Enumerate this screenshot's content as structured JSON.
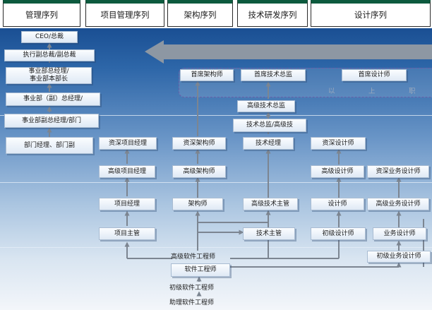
{
  "header": {
    "tabs": [
      {
        "id": "management",
        "label": "管理序列"
      },
      {
        "id": "project-management",
        "label": "项目管理序列"
      },
      {
        "id": "architecture",
        "label": "架构序列"
      },
      {
        "id": "tech-development",
        "label": "技术研发序列"
      },
      {
        "id": "design",
        "label": "设计序列"
      }
    ]
  },
  "colors": {
    "background_top": "#1a4f93",
    "background_bottom": "#f3f6fa",
    "tab_bar_accent": "#0d5a3e",
    "arrow": "#8d97a3",
    "arrow_connector": "#7c8591",
    "dashed_group_border": "#6a5fa8"
  },
  "management": {
    "ceo": "CEO/总裁",
    "evp": "执行副总裁/副总裁",
    "division_gm": "事业部总经理/\n事业部本部长",
    "division_deputy_gm": "事业部（副）总经理/",
    "division_vice_gm_dept": "事业部副总经理/部门",
    "dept_manager": "部门经理、部门副"
  },
  "project_management": {
    "senior_pm": "资深项目经理",
    "advanced_pm": "高级项目经理",
    "pm": "项目经理",
    "project_lead": "项目主管"
  },
  "architecture": {
    "chief_architect": "首席架构师",
    "senior_architect": "资深架构师",
    "advanced_architect": "高级架构师",
    "architect": "架构师"
  },
  "tech_development": {
    "chief_tech_director": "首席技术总监",
    "advanced_tech_director": "高级技术总监",
    "tech_director": "技术总监/高级技",
    "tech_manager": "技术经理",
    "advanced_tech_lead": "高级技术主管",
    "tech_lead": "技术主管"
  },
  "design": {
    "chief_designer": "首席设计师",
    "senior_designer": "资深设计师",
    "advanced_designer": "高级设计师",
    "designer": "设计师",
    "junior_designer": "初级设计师",
    "senior_business_designer": "资深业务设计师",
    "advanced_business_designer": "高级业务设计师",
    "business_designer": "业务设计师",
    "junior_business_designer": "初级业务设计师"
  },
  "engineering": {
    "advanced_engineer": "高级软件工程师",
    "engineer": "软件工程师",
    "junior_engineer": "初级软件工程师",
    "assistant_engineer": "助理软件工程师"
  },
  "top_group_note": {
    "chars": [
      "以",
      "上",
      "职"
    ]
  }
}
